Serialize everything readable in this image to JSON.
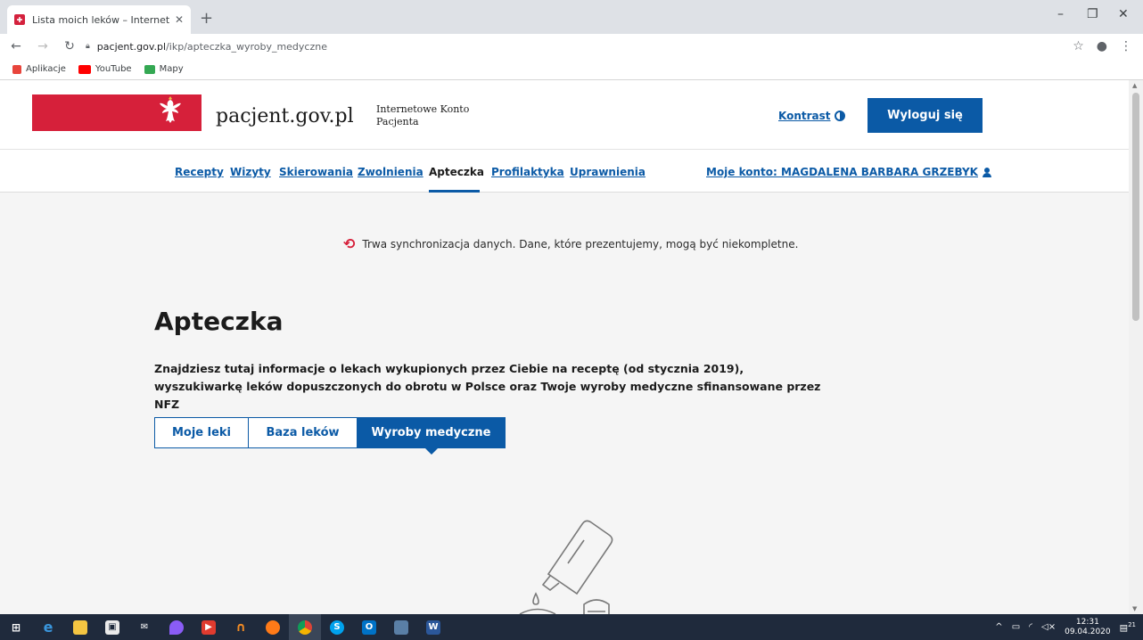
{
  "browser": {
    "tab_title": "Lista moich leków – Internetowe",
    "url_host": "pacjent.gov.pl",
    "url_path": "/ikp/apteczka_wyroby_medyczne",
    "bookmarks": [
      {
        "label": "Aplikacje",
        "color": "#e8453c"
      },
      {
        "label": "YouTube",
        "color": "#ff0000"
      },
      {
        "label": "Mapy",
        "color": "#34a853"
      }
    ]
  },
  "header": {
    "logo_text": "pacjent.gov.pl",
    "ikp_line1": "Internetowe Konto",
    "ikp_line2": "Pacjenta",
    "kontrast_label": "Kontrast",
    "logout_label": "Wyloguj się"
  },
  "nav": {
    "items": [
      {
        "label": "Recepty"
      },
      {
        "label": "Wizyty"
      },
      {
        "label": "Skierowania"
      },
      {
        "label": "Zwolnienia"
      },
      {
        "label": "Apteczka"
      },
      {
        "label": "Profilaktyka"
      },
      {
        "label": "Uprawnienia"
      }
    ],
    "active": "Apteczka",
    "account_label": "Moje konto: MAGDALENA BARBARA GRZEBYK"
  },
  "sync_message": "Trwa synchronizacja danych. Dane, które prezentujemy, mogą być niekompletne.",
  "main": {
    "title": "Apteczka",
    "description": "Znajdziesz tutaj informacje o lekach wykupionych przez Ciebie na receptę (od stycznia 2019), wyszukiwarkę leków dopuszczonych do obrotu w Polsce oraz Twoje wyroby medyczne sfinansowane przez NFZ",
    "tabs": [
      {
        "label": "Moje leki"
      },
      {
        "label": "Baza leków"
      },
      {
        "label": "Wyroby medyczne"
      }
    ],
    "selected_tab": "Wyroby medyczne"
  },
  "taskbar": {
    "time": "12:31",
    "date": "09.04.2020",
    "notification_count": "21"
  },
  "colors": {
    "brand_blue": "#0b5aa6",
    "brand_red": "#d6203a"
  }
}
